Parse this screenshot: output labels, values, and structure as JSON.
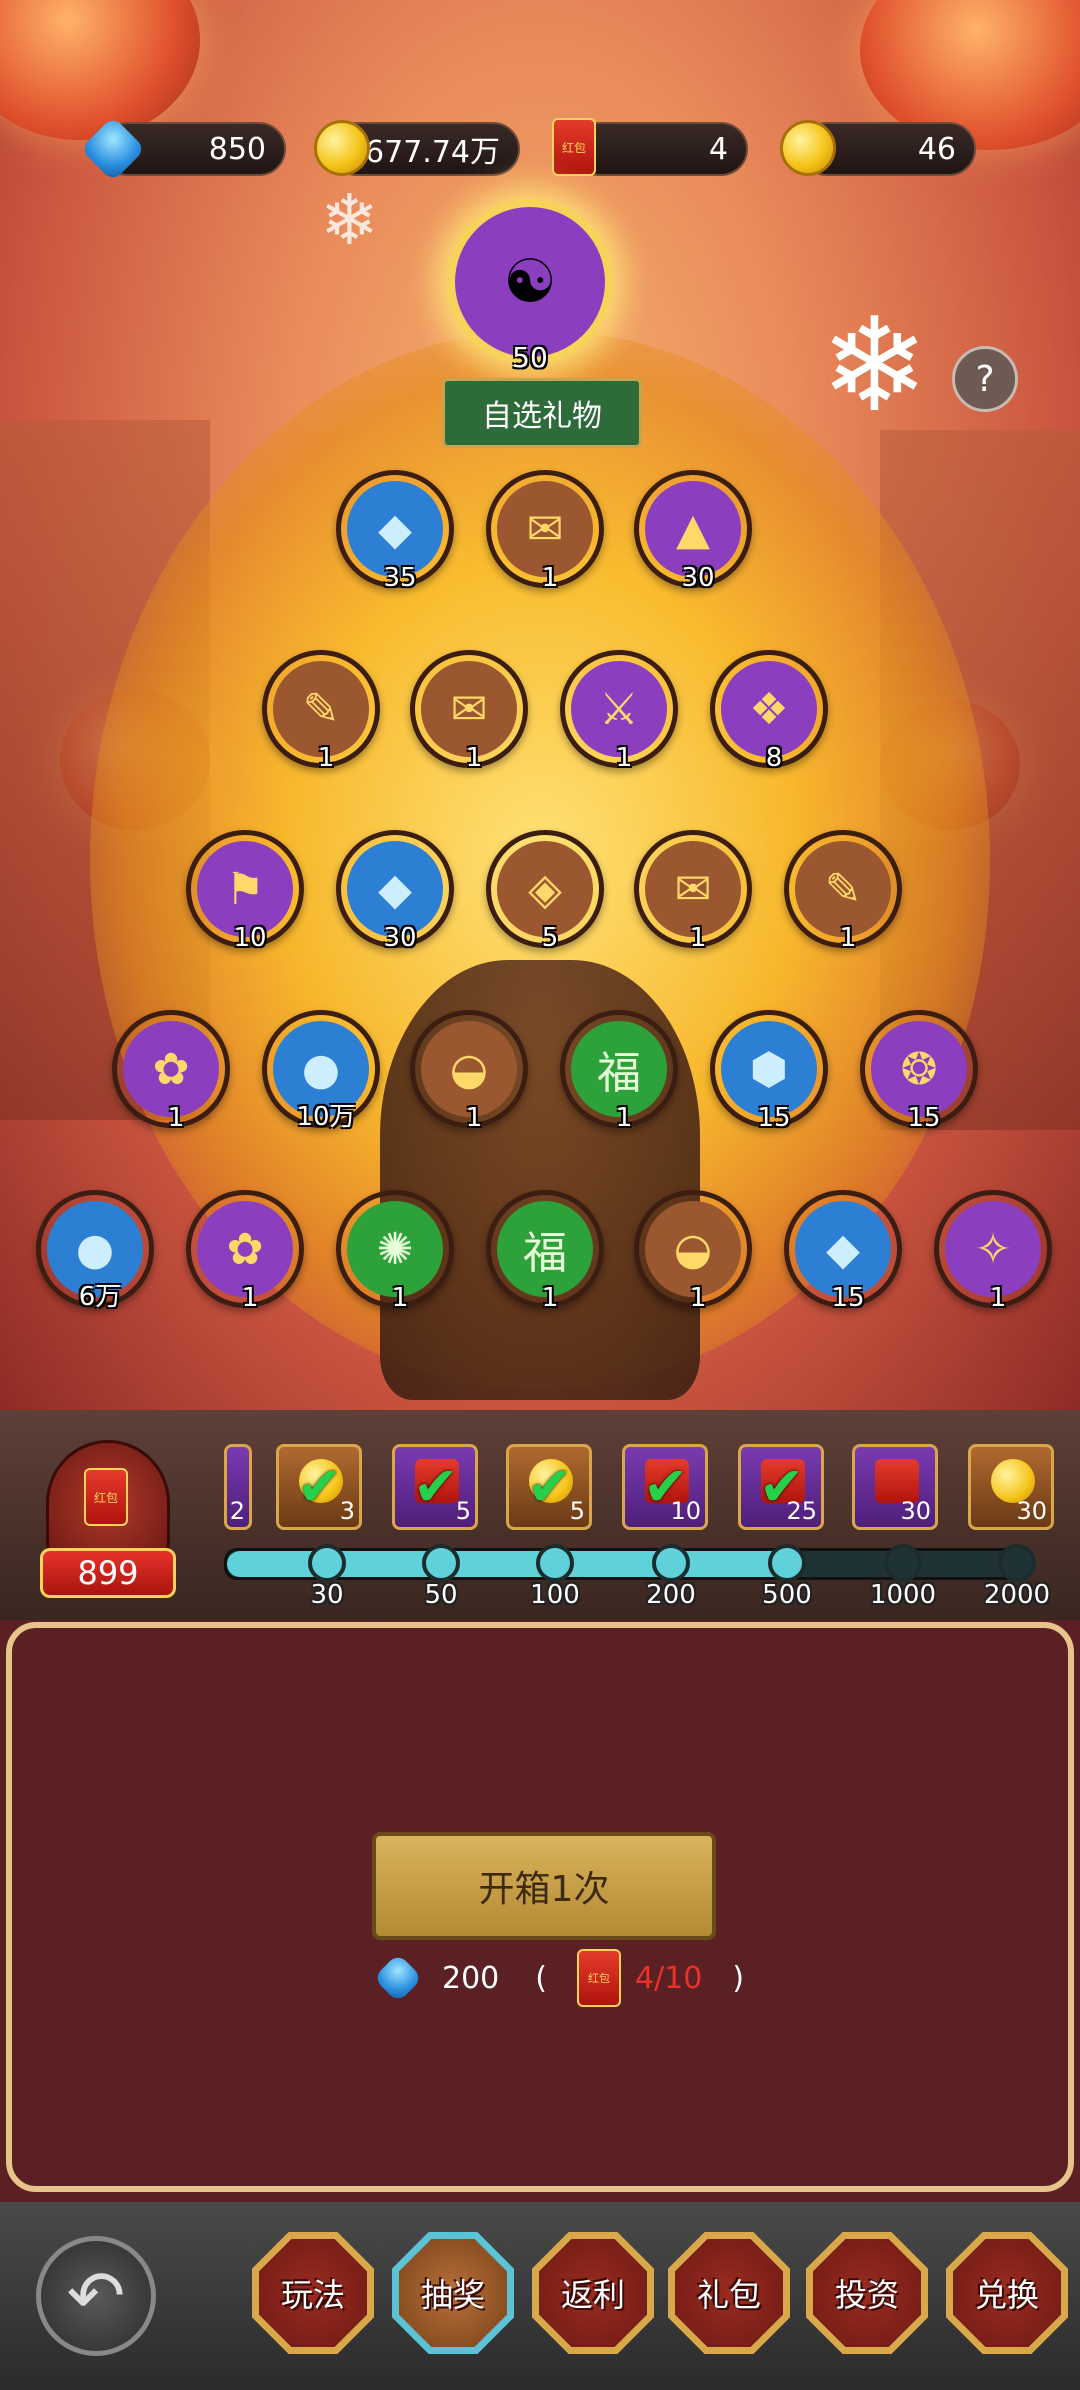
{
  "resources": {
    "diamonds": "850",
    "gold": "677.74万",
    "red_envelopes": "4",
    "ingots": "46",
    "envelope_label": "红包"
  },
  "grand_prize": {
    "count": "50",
    "label": "自选礼物",
    "icon": "coins-icon"
  },
  "help_label": "?",
  "rows": [
    [
      {
        "icon": "diamond-gem-icon",
        "count": "35",
        "color": "blue"
      },
      {
        "icon": "scroll-icon",
        "count": "1",
        "color": "brown"
      },
      {
        "icon": "sand-pile-icon",
        "count": "30",
        "color": "purple"
      }
    ],
    [
      {
        "icon": "scroll-bell-icon",
        "count": "1",
        "color": "brown"
      },
      {
        "icon": "scroll-icon",
        "count": "1",
        "color": "brown"
      },
      {
        "icon": "sword-icon",
        "count": "1",
        "color": "purple"
      },
      {
        "icon": "rune-tile-icon",
        "count": "8",
        "color": "purple"
      }
    ],
    [
      {
        "icon": "banner-icon",
        "count": "10",
        "color": "purple"
      },
      {
        "icon": "diamond-gem-icon",
        "count": "30",
        "color": "blue"
      },
      {
        "icon": "gold-gem-icon",
        "count": "5",
        "color": "brown"
      },
      {
        "icon": "scroll-icon",
        "count": "1",
        "color": "brown"
      },
      {
        "icon": "scroll-bell-icon",
        "count": "1",
        "color": "brown"
      }
    ],
    [
      {
        "icon": "jade-bag-icon",
        "count": "1",
        "color": "purple"
      },
      {
        "icon": "gold-coin-icon",
        "count": "10万",
        "color": "blue"
      },
      {
        "icon": "ingot-icon",
        "count": "1",
        "color": "brown"
      },
      {
        "icon": "fu-token-icon",
        "count": "1",
        "color": "green"
      },
      {
        "icon": "crystal-icon",
        "count": "15",
        "color": "blue"
      },
      {
        "icon": "dragon-seal-icon",
        "count": "15",
        "color": "purple"
      }
    ],
    [
      {
        "icon": "gold-coin-icon",
        "count": "6万",
        "color": "blue"
      },
      {
        "icon": "jade-bag-icon",
        "count": "1",
        "color": "purple"
      },
      {
        "icon": "jade-disc-icon",
        "count": "1",
        "color": "green"
      },
      {
        "icon": "fu-token-icon",
        "count": "1",
        "color": "green"
      },
      {
        "icon": "ingot-icon",
        "count": "1",
        "color": "brown"
      },
      {
        "icon": "diamond-gem-icon",
        "count": "15",
        "color": "blue"
      },
      {
        "icon": "bundle-scroll-icon",
        "count": "1",
        "color": "purple"
      }
    ]
  ],
  "progress": {
    "current": "899",
    "bag_label": "红包",
    "rewards": [
      {
        "count": "2",
        "style": "p",
        "claimed": false,
        "partial": true
      },
      {
        "count": "3",
        "style": "b",
        "claimed": true
      },
      {
        "count": "5",
        "style": "p",
        "claimed": true
      },
      {
        "count": "5",
        "style": "b",
        "claimed": true
      },
      {
        "count": "10",
        "style": "p",
        "claimed": true
      },
      {
        "count": "25",
        "style": "p",
        "claimed": true
      },
      {
        "count": "30",
        "style": "p",
        "claimed": false
      },
      {
        "count": "30",
        "style": "b",
        "claimed": false
      }
    ],
    "milestones": [
      "30",
      "50",
      "100",
      "200",
      "500",
      "1000",
      "2000"
    ],
    "reached": 5
  },
  "panel": {
    "open_button": "开箱1次",
    "cost_diamonds": "200",
    "open_paren": "(",
    "envelope_progress": "4/10",
    "close_paren": ")"
  },
  "colors": {
    "accent_red": "#e8322b",
    "progress_cyan": "#5fd1d8"
  },
  "nav": {
    "back_icon": "back-arrow-icon",
    "tabs": [
      "玩法",
      "抽奖",
      "返利",
      "礼包",
      "投资",
      "兑换"
    ],
    "active": 1
  }
}
